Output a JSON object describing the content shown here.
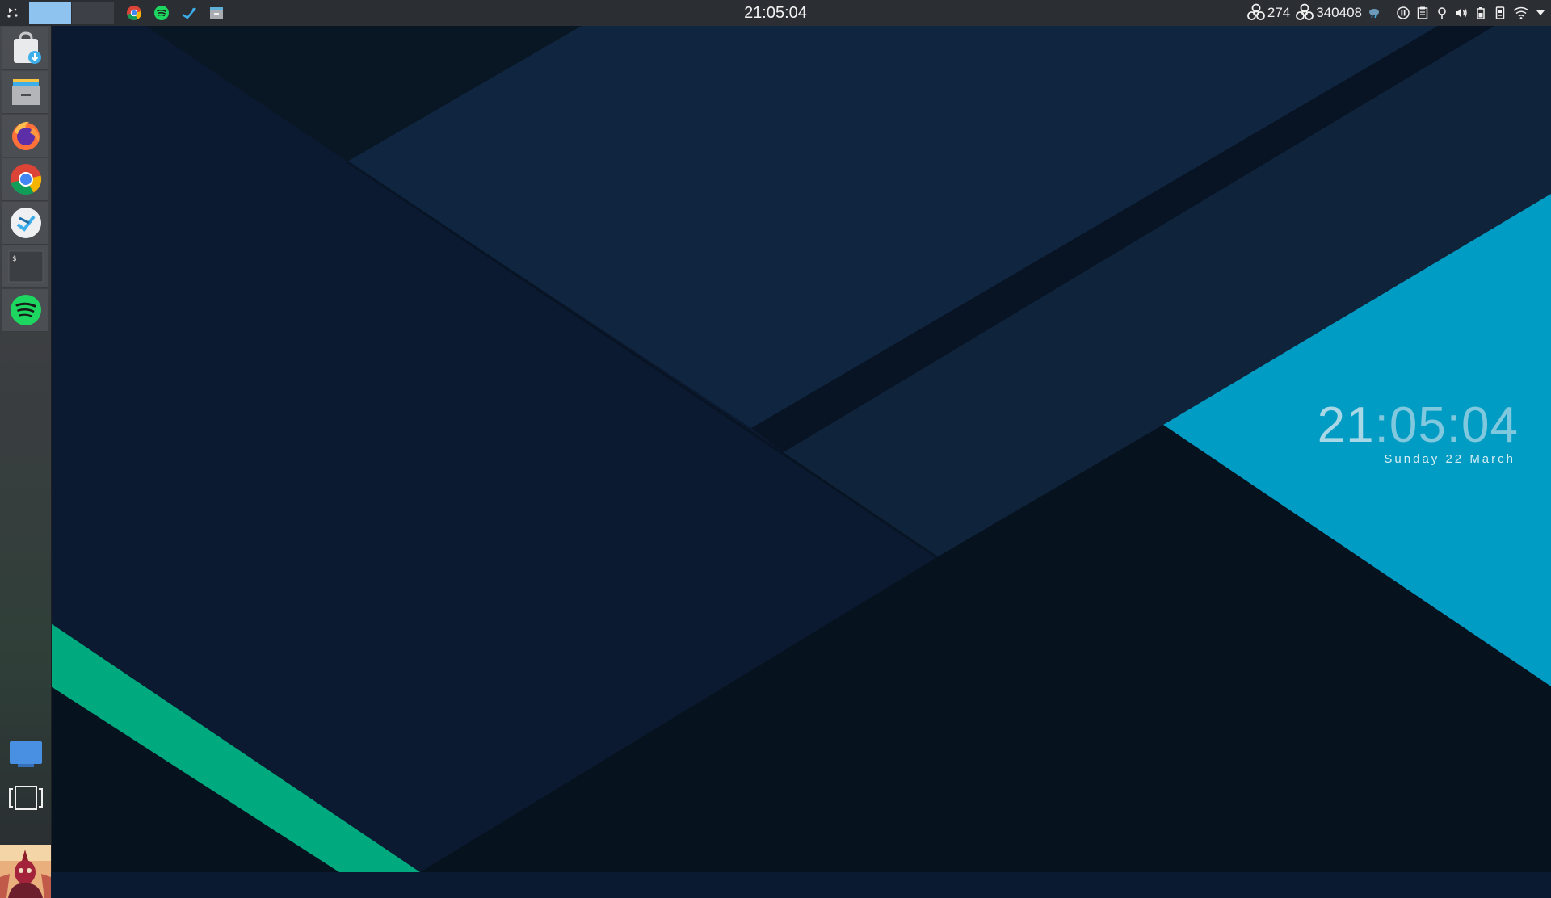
{
  "panel": {
    "clock": "21:05:04",
    "launcher_icon": "kde-menu-icon",
    "pager": {
      "active_desktop": 1,
      "desktops": 2
    },
    "tasks": [
      {
        "name": "chrome-task",
        "icon": "chrome-icon"
      },
      {
        "name": "spotify-task",
        "icon": "spotify-icon"
      },
      {
        "name": "kdeconnect-task",
        "icon": "kdeconnect-icon"
      },
      {
        "name": "file-manager-task",
        "icon": "archive-icon"
      }
    ],
    "tray": {
      "counter_one": "274",
      "counter_two": "340408",
      "items": [
        "biohazard-icon",
        "biohazard-icon",
        "weather-icon",
        "media-pause-icon",
        "clipboard-icon",
        "location-icon",
        "volume-icon",
        "battery-icon",
        "device-icon",
        "wifi-icon",
        "tray-expand-icon"
      ]
    }
  },
  "dock": {
    "items": [
      {
        "name": "software-center",
        "icon": "store-download-icon"
      },
      {
        "name": "file-manager",
        "icon": "folder-icon"
      },
      {
        "name": "firefox",
        "icon": "firefox-icon"
      },
      {
        "name": "chrome",
        "icon": "chrome-icon"
      },
      {
        "name": "kdeconnect",
        "icon": "kdeconnect-icon"
      },
      {
        "name": "terminal",
        "icon": "terminal-icon"
      },
      {
        "name": "spotify",
        "icon": "spotify-icon"
      }
    ],
    "terminal_prompt": "$_",
    "bottom": [
      "desktop-show-icon",
      "window-overview-icon",
      "user-avatar"
    ]
  },
  "desktop_clock": {
    "hours": "21",
    "rest": ":05:04",
    "date": "Sunday 22 March"
  },
  "colors": {
    "panel_bg": "#2b2e33",
    "wall_dark": "#081320",
    "wall_navy": "#0b1a30",
    "wall_mid": "#0f243d",
    "wall_cyan": "#009cc3",
    "wall_green": "#00a97e"
  }
}
